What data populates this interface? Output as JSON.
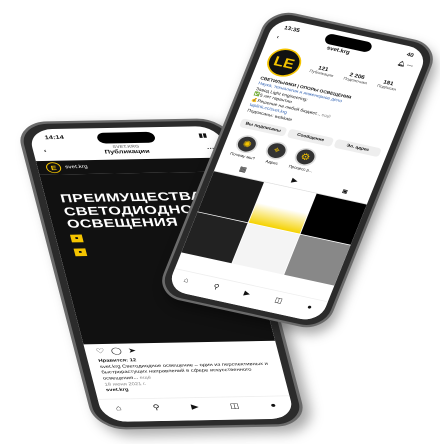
{
  "post_phone": {
    "time": "14:14",
    "account_caps": "SVET.KRG",
    "title": "Публикации",
    "username": "svet.krg",
    "post_heading": "ПРЕИМУЩЕСТВА СВЕТОДИОДНОГО ОСВЕЩЕНИЯ",
    "likes": "Нравится: 12",
    "caption": "svet.krg Светодиодное освещение – один из перспективных и быстрорастущих направлений в сфере искусственного освещения...",
    "more": "ещё",
    "date": "18 июня 2021 г.",
    "next_username": "svet.krg"
  },
  "profile_phone": {
    "time": "13:35",
    "battery": "40",
    "username": "svet.krg",
    "stats": [
      {
        "value": "121",
        "label": "Публикации"
      },
      {
        "value": "2 206",
        "label": "Подписчики"
      },
      {
        "value": "181",
        "label": "Подписки"
      }
    ],
    "name": "СВЕТИЛЬНИКИ | ОПОРЫ ОСВЕЩЕНИЯ",
    "category": "Наука, технологии и инженерное дело",
    "bio": [
      "Завод Light engineering:",
      "✅5 лет гарантии",
      "💰Решение на любой бюджет..."
    ],
    "more": "ещё",
    "link": "taplink.cc/svet.krg",
    "followed_by": "Подписаны: webkate",
    "buttons": [
      "Вы подписаны",
      "Сообщение",
      "Эл. адрес"
    ],
    "highlights": [
      "Почему мы?",
      "Адрес",
      "Процесс р..."
    ]
  },
  "colors": {
    "accent": "#f5c400",
    "dark": "#111111"
  }
}
